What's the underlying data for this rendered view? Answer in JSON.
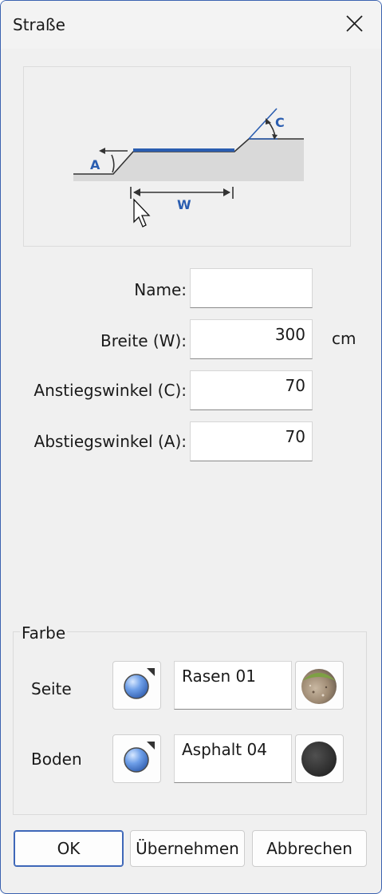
{
  "window": {
    "title": "Straße"
  },
  "diagram": {
    "label_a": "A",
    "label_c": "C",
    "label_w": "W"
  },
  "form": {
    "name_label": "Name:",
    "name_value": "",
    "width_label": "Breite (W):",
    "width_value": "300",
    "width_unit": "cm",
    "rise_label": "Anstiegswinkel (C):",
    "rise_value": "70",
    "fall_label": "Abstiegswinkel (A):",
    "fall_value": "70"
  },
  "color_group": {
    "title": "Farbe",
    "side": {
      "label": "Seite",
      "material": "Rasen 01"
    },
    "floor": {
      "label": "Boden",
      "material": "Asphalt 04"
    }
  },
  "buttons": {
    "ok": "OK",
    "apply": "Übernehmen",
    "cancel": "Abbrechen"
  },
  "colors": {
    "accent": "#2a5db0",
    "window_border": "#3b62b0"
  }
}
